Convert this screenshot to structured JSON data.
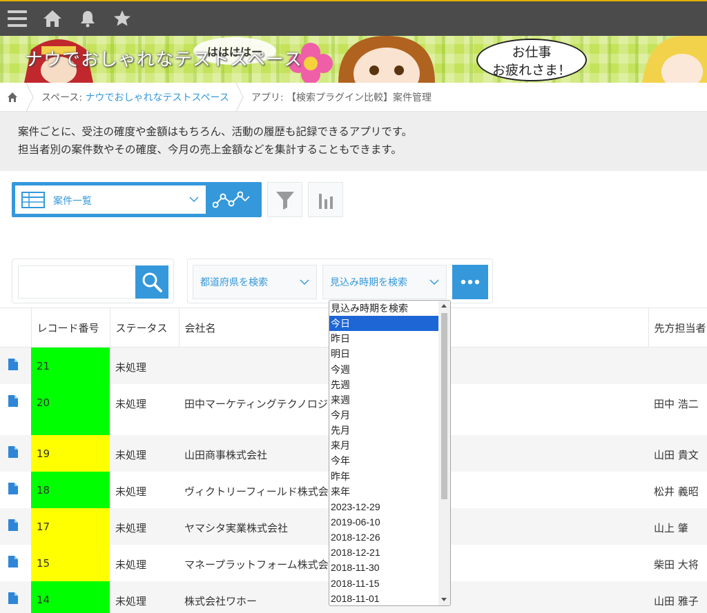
{
  "banner": {
    "title": "ナウでおしゃれなテストスペース",
    "burst_text": "ははははー",
    "bubble_line1": "お仕事",
    "bubble_line2": "お疲れさま！"
  },
  "breadcrumb": {
    "space_prefix": "スペース: ",
    "space_name": "ナウでおしゃれなテストスペース",
    "app_label": "アプリ: 【検索プラグイン比較】案件管理"
  },
  "description": {
    "line1": "案件ごとに、受注の確度や金額はもちろん、活動の履歴も記録できるアプリです。",
    "line2": "担当者別の案件数やその確度、今月の売上金額などを集計することもできます。"
  },
  "view": {
    "selected": "案件一覧"
  },
  "search": {
    "placeholder": ""
  },
  "filters": {
    "prefecture_placeholder": "都道府県を検索",
    "period_placeholder": "見込み時期を検索"
  },
  "table": {
    "headers": [
      "",
      "レコード番号",
      "ステータス",
      "会社名",
      "",
      "先方担当者"
    ],
    "rows": [
      {
        "id": "21",
        "status": "未処理",
        "company": "",
        "contact": "",
        "color": "green"
      },
      {
        "id": "20",
        "status": "未処理",
        "company": "田中マーケティングテクノロジー",
        "contact": "田中 浩二",
        "color": "green"
      },
      {
        "id": "19",
        "status": "未処理",
        "company": "山田商事株式会社",
        "contact": "山田 貴文",
        "color": "yellow"
      },
      {
        "id": "18",
        "status": "未処理",
        "company": "ヴィクトリーフィールド株式会社",
        "contact": "松井 義昭",
        "color": "green"
      },
      {
        "id": "17",
        "status": "未処理",
        "company": "ヤマシタ実業株式会社",
        "contact": "山上 肇",
        "color": "yellow"
      },
      {
        "id": "15",
        "status": "未処理",
        "company": "マネープラットフォーム株式会社",
        "contact": "柴田 大将",
        "color": "yellow"
      },
      {
        "id": "14",
        "status": "未処理",
        "company": "株式会社ワホー",
        "contact": "山田 雅子",
        "color": "green"
      }
    ]
  },
  "dropdown": {
    "options": [
      "見込み時期を検索",
      "今日",
      "昨日",
      "明日",
      "今週",
      "先週",
      "来週",
      "今月",
      "先月",
      "来月",
      "今年",
      "昨年",
      "来年",
      "2023-12-29",
      "2019-06-10",
      "2018-12-26",
      "2018-12-21",
      "2018-11-30",
      "2018-11-15",
      "2018-11-01"
    ],
    "selected_index": 1
  },
  "colors": {
    "accent": "#3498db",
    "topbar": "#4b4b4b",
    "green": "#00ff00",
    "yellow": "#ffff00",
    "selected": "#1e66d6"
  },
  "icons": [
    "menu-icon",
    "home-icon",
    "bell-icon",
    "star-icon",
    "table-view-icon",
    "graph-icon",
    "filter-icon",
    "chart-icon",
    "search-icon",
    "more-icon",
    "record-detail-icon"
  ]
}
